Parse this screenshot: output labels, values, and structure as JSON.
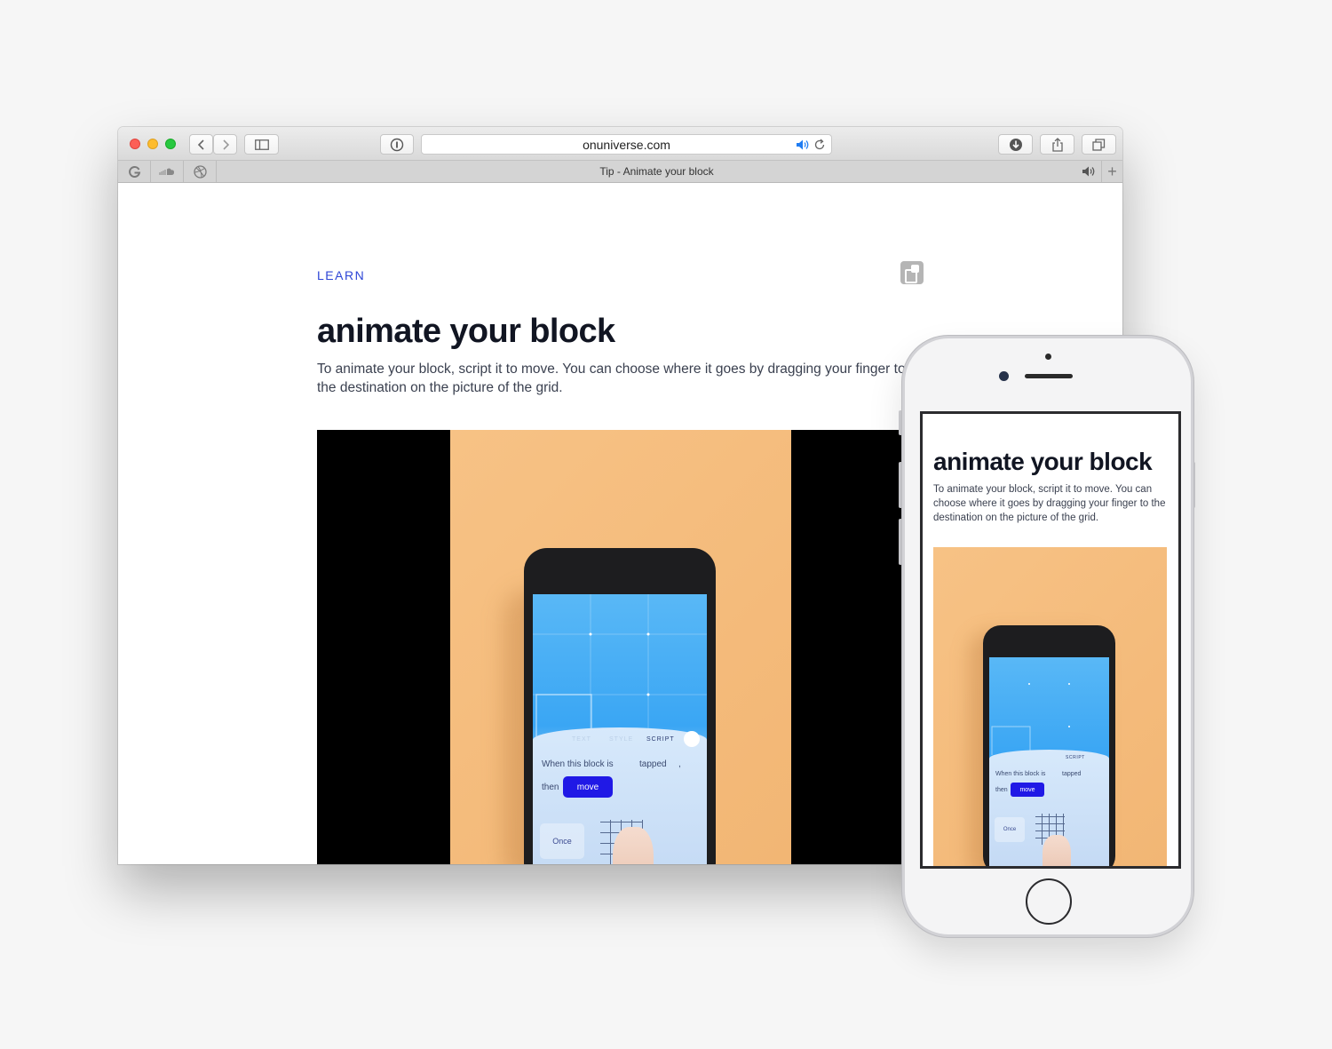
{
  "browser": {
    "url": "onuniverse.com",
    "tab_title": "Tip - Animate your block",
    "toolbar_icons": [
      "back-icon",
      "forward-icon",
      "sidebar-icon",
      "reader-icon",
      "speaker-icon",
      "reload-icon",
      "download-icon",
      "share-icon",
      "tabs-icon"
    ],
    "pinned_tabs": [
      "google-icon",
      "soundcloud-icon",
      "dribbble-icon"
    ],
    "add_tab_label": "+"
  },
  "article": {
    "eyebrow": "LEARN",
    "title": "animate your block",
    "description": "To animate your block, script it to move. You can choose where it goes by dragging your finger to the destination on the picture of the grid."
  },
  "video_app": {
    "tab_text": "TEXT",
    "tab_style": "STYLE",
    "tab_script": "SCRIPT",
    "when_text": "When this block is",
    "tapped_text": "tapped",
    "comma": ",",
    "then_text": "then",
    "move_text": "move",
    "once_text": "Once"
  },
  "mobile": {
    "title": "animate your block",
    "description": "To animate your block, script it to move. You can choose where it goes by dragging your finger to the destination on the picture of the grid."
  },
  "colors": {
    "accent": "#2d45d6",
    "title": "#111522",
    "move_pill": "#2019e6",
    "video_bg": "#f2b674"
  }
}
